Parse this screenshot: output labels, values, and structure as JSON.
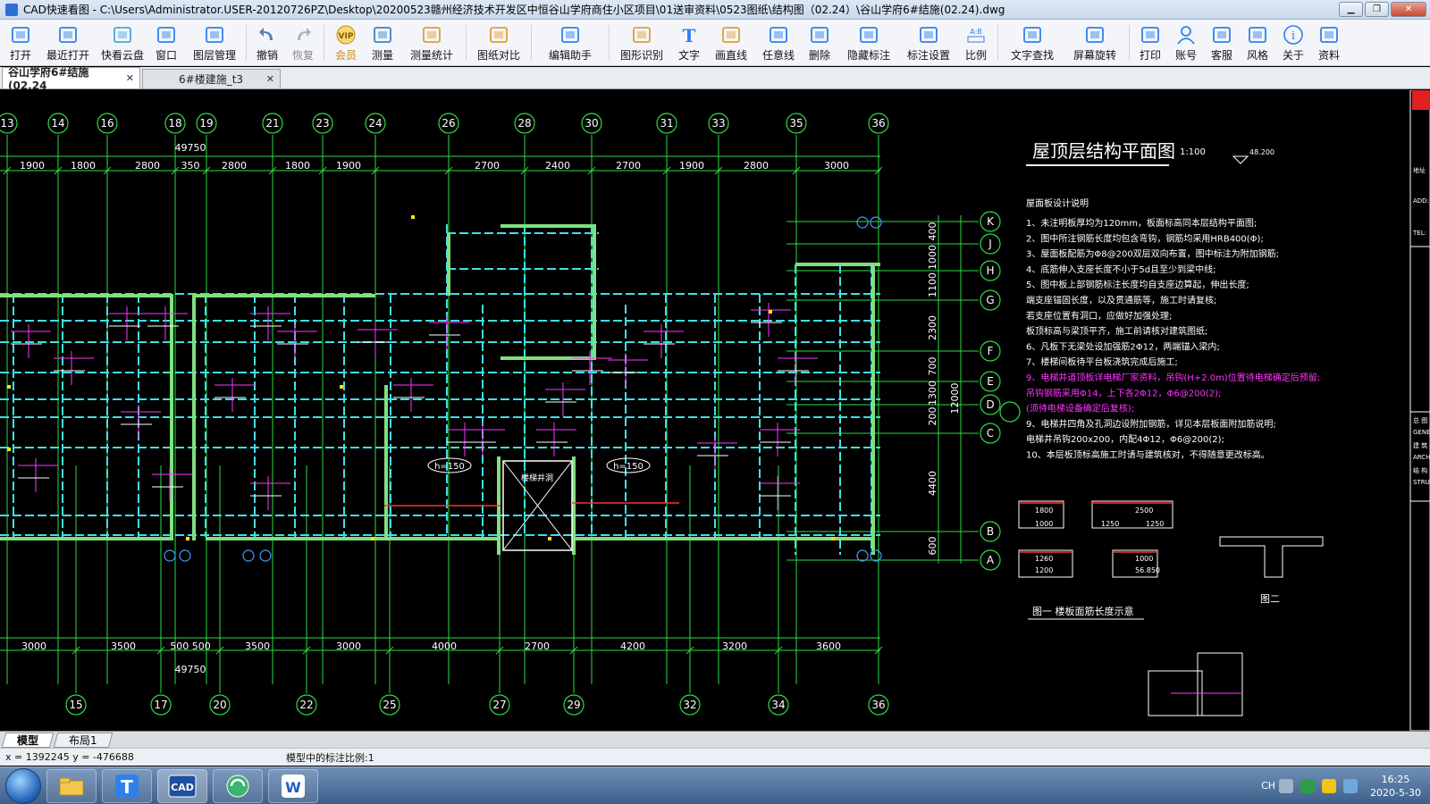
{
  "window": {
    "title": "CAD快速看图 - C:\\Users\\Administrator.USER-20120726PZ\\Desktop\\20200523赣州经济技术开发区中恒谷山学府商住小区项目\\01送审资料\\0523图纸\\结构图（02.24）\\谷山学府6#结施(02.24).dwg"
  },
  "toolbar": [
    {
      "label": "打开",
      "icon": "folder-open-icon"
    },
    {
      "label": "最近打开",
      "icon": "history-icon"
    },
    {
      "label": "快看云盘",
      "icon": "cloud-icon"
    },
    {
      "label": "窗口",
      "icon": "window-icon"
    },
    {
      "label": "图层管理",
      "icon": "layers-icon"
    },
    {
      "label": "撤销",
      "icon": "undo-icon"
    },
    {
      "label": "恢复",
      "icon": "redo-icon"
    },
    {
      "label": "会员",
      "icon": "vip-icon"
    },
    {
      "label": "测量",
      "icon": "measure-icon"
    },
    {
      "label": "测量统计",
      "icon": "measure-stats-icon"
    },
    {
      "label": "图纸对比",
      "icon": "compare-icon"
    },
    {
      "label": "编辑助手",
      "icon": "edit-assistant-icon"
    },
    {
      "label": "图形识别",
      "icon": "shape-recognize-icon"
    },
    {
      "label": "文字",
      "icon": "text-icon"
    },
    {
      "label": "画直线",
      "icon": "line-icon"
    },
    {
      "label": "任意线",
      "icon": "freehand-icon"
    },
    {
      "label": "删除",
      "icon": "eraser-icon"
    },
    {
      "label": "隐藏标注",
      "icon": "hide-annotation-icon"
    },
    {
      "label": "标注设置",
      "icon": "annotation-settings-icon"
    },
    {
      "label": "比例",
      "icon": "scale-icon"
    },
    {
      "label": "文字查找",
      "icon": "text-search-icon"
    },
    {
      "label": "屏幕旋转",
      "icon": "rotate-icon"
    },
    {
      "label": "打印",
      "icon": "printer-icon"
    },
    {
      "label": "账号",
      "icon": "user-icon"
    },
    {
      "label": "客服",
      "icon": "headset-icon"
    },
    {
      "label": "风格",
      "icon": "style-icon"
    },
    {
      "label": "关于",
      "icon": "info-icon"
    },
    {
      "label": "资料",
      "icon": "document-icon"
    }
  ],
  "tabs": [
    {
      "label": "谷山学府6#结施(02.24",
      "active": true
    },
    {
      "label": "6#楼建施_t3",
      "active": false
    }
  ],
  "drawing": {
    "top_axes": [
      "13",
      "14",
      "16",
      "18",
      "19",
      "21",
      "23",
      "24",
      "26",
      "28",
      "30",
      "31",
      "33",
      "35",
      "36"
    ],
    "bottom_axes": [
      "15",
      "17",
      "20",
      "22",
      "25",
      "27",
      "29",
      "32",
      "34",
      "36"
    ],
    "side_axes": [
      "K",
      "J",
      "H",
      "G",
      "F",
      "E",
      "D",
      "C",
      "B",
      "A"
    ],
    "top_total": "49750",
    "bottom_total": "49750",
    "top_dims": [
      "1900",
      "1800",
      "2800",
      "350",
      "2800",
      "1800",
      "1900",
      "2700",
      "2400",
      "2700",
      "1900",
      "2800",
      "3000"
    ],
    "bottom_dims": [
      "3000",
      "3500",
      "500 500",
      "3500",
      "3000",
      "4000",
      "2700",
      "4200",
      "3200",
      "3600"
    ],
    "vertical_dims": [
      "400",
      "1000",
      "1100",
      "2300",
      "700",
      "1300",
      "200",
      "4400",
      "600"
    ],
    "vertical_total": "12000",
    "plan_title": "屋顶层结构平面图",
    "plan_scale": "1:100",
    "level_mark": "48.200",
    "slab_labels": [
      "h=150",
      "h=150"
    ],
    "void_label": "楼梯井洞",
    "notes_title": "屋面板设计说明",
    "notes": [
      "1、未注明板厚均为120mm，板面标高同本层结构平面图;",
      "2、图中所注钢筋长度均包含弯钩，钢筋均采用HRB400(Φ);",
      "3、屋面板配筋为Φ8@200双层双向布置，图中标注为附加钢筋;",
      "4、底筋伸入支座长度不小于5d且至少到梁中线;",
      "5、图中板上部钢筋标注长度均自支座边算起，伸出长度;",
      "    端支座锚固长度，以及贯通筋等，施工时请复核;",
      "    若支座位置有洞口，应做好加强处理;",
      "    板顶标高与梁顶平齐，施工前请核对建筑图纸;",
      "6、凡板下无梁处设加强筋2Φ12，两端锚入梁内;",
      "7、楼梯间板待平台板浇筑完成后施工;",
      "9、电梯井道顶板详电梯厂家资料，吊钩(H+2.0m)位置待电梯确定后预留;",
      "    吊钩钢筋采用Φ14，上下各2Φ12，Φ6@200(2);",
      "    (须待电梯设备确定后复核);",
      "9、电梯井四角及孔洞边设附加钢筋，详见本层板面附加筋说明;",
      "    电梯井吊钩200x200，内配4Φ12，Φ6@200(2);",
      "10、本层板顶标高施工时请与建筑核对，不得随意更改标高。"
    ],
    "detail_title_1": "图一  楼板面筋长度示意",
    "detail_title_2": "图二",
    "detail_values": [
      "1800",
      "1000",
      "2500",
      "1250",
      "1250",
      "1260",
      "1200",
      "1000",
      "56.850"
    ],
    "title_block": [
      "地址",
      "ADD:",
      "TEL:",
      "总  图",
      "GENERAL",
      "建  筑",
      "ARCHI.",
      "结  构",
      "STRUCT."
    ]
  },
  "layout_tabs": [
    {
      "label": "模型",
      "active": true
    },
    {
      "label": "布局1",
      "active": false
    }
  ],
  "status": {
    "coords": "x = 1392245  y = -476688",
    "scale_text": "模型中的标注比例:1"
  },
  "taskbar": {
    "apps": [
      "explorer",
      "t-app",
      "cad-app",
      "browser",
      "wps"
    ],
    "lang": "CH",
    "time": "16:25",
    "date": "2020-5-30"
  }
}
